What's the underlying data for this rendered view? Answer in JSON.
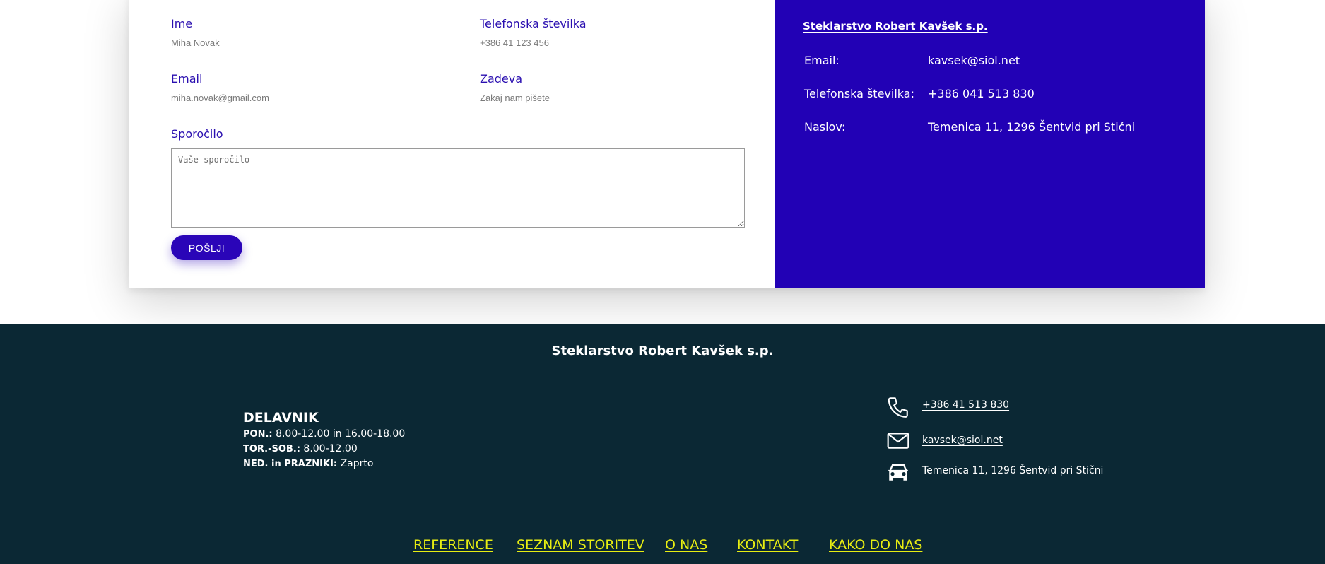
{
  "form": {
    "name_label": "Ime",
    "name_placeholder": "Miha Novak",
    "phone_label": "Telefonska številka",
    "phone_placeholder": "+386 41 123 456",
    "email_label": "Email",
    "email_placeholder": "miha.novak@gmail.com",
    "subject_label": "Zadeva",
    "subject_placeholder": "Zakaj nam pišete",
    "message_label": "Sporočilo",
    "message_placeholder": "Vaše sporočilo",
    "submit_label": "POŠLJI"
  },
  "info": {
    "company": "Steklarstvo Robert Kavšek s.p.",
    "rows": [
      {
        "label": "Email:",
        "value": "kavsek@siol.net"
      },
      {
        "label": "Telefonska številka:",
        "value": "+386 041 513 830"
      },
      {
        "label": "Naslov:",
        "value": "Temenica 11, 1296 Šentvid pri Stični"
      }
    ],
    "background": "#2201b5"
  },
  "footer": {
    "company": "Steklarstvo Robert Kavšek s.p.",
    "hours": {
      "heading": "DELAVNIK",
      "lines": [
        {
          "label": "PON.:",
          "value": "8.00-12.00 in 16.00-18.00"
        },
        {
          "label": "TOR.-SOB.:",
          "value": "8.00-12.00"
        },
        {
          "label": "NED. in PRAZNIKI:",
          "value": "Zaprto"
        }
      ]
    },
    "contacts": [
      {
        "icon": "phone-icon",
        "text": "+386 41 513 830"
      },
      {
        "icon": "mail-icon",
        "text": "kavsek@siol.net"
      },
      {
        "icon": "car-icon",
        "text": "Temenica 11, 1296 Šentvid pri Stični"
      }
    ],
    "nav": [
      "REFERENCE",
      "SEZNAM STORITEV",
      "O NAS",
      "KONTAKT",
      "KAKO DO NAS"
    ],
    "background": "#0b2834",
    "nav_color": "#e8ee12"
  }
}
